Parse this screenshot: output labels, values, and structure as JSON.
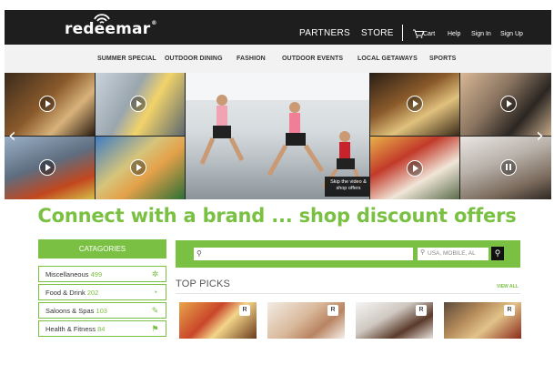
{
  "brand": {
    "logo_text": "redeemar",
    "registered_mark": "®"
  },
  "topnav": {
    "partners": "PARTNERS",
    "store": "STORE",
    "cart": "Cart",
    "help": "Help",
    "sign_in": "Sign In",
    "sign_up": "Sign Up"
  },
  "categories_bar": [
    "SUMMER SPECIAL",
    "OUTDOOR DINING",
    "FASHION",
    "OUTDOOR EVENTS",
    "LOCAL GETAWAYS",
    "SPORTS"
  ],
  "gallery": {
    "skip_text_line1": "Skip the video &",
    "skip_text_line2": "shop offers",
    "prev_arrow": "‹",
    "next_arrow": "›"
  },
  "tagline": "Connect with a brand ... shop discount offers",
  "sidebar": {
    "title": "CATAGORIES",
    "items": [
      {
        "label": "Miscellaneous",
        "count": "499",
        "icon": "misc-icon"
      },
      {
        "label": "Food & Drink",
        "count": "202",
        "icon": "food-icon"
      },
      {
        "label": "Saloons & Spas",
        "count": "103",
        "icon": "spa-icon"
      },
      {
        "label": "Health & Fitness",
        "count": "84",
        "icon": "fitness-icon"
      }
    ]
  },
  "search": {
    "query_placeholder": "",
    "location_placeholder": "USA, MOBILE, AL",
    "go_label": "⚲"
  },
  "top_picks": {
    "title": "TOP PICKS",
    "view_all": "VIEW ALL",
    "badge_text": "R"
  },
  "colors": {
    "accent": "#7ac143",
    "topbar": "#1e1e1e",
    "catbar": "#f2f2f2"
  }
}
